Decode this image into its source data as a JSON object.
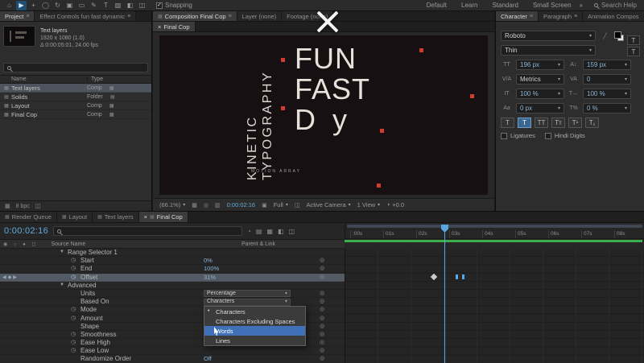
{
  "icons": {
    "menu": "≡",
    "chevron": "▾",
    "twirl": "▼",
    "stopwatch": "◷",
    "pickwhip": "◎",
    "diamond": "◆",
    "nav_left": "◀",
    "nav_right": "▶",
    "dot": "•",
    "close": "×",
    "panel": "▦",
    "check": "✓",
    "folder": "▤",
    "eyedropper": "╱",
    "more": "»",
    "exposure": "◑",
    "target": "◎",
    "grid": "▦",
    "mask": "▥",
    "camera": "▣",
    "view_layout": "◫",
    "col_icons": "◉ ○ ● ◻",
    "tl_icons_1": "◔",
    "tl_icons_2": "▤",
    "tl_icons_3": "▦",
    "tl_icons_4": "◧",
    "tl_icons_5": "◫"
  },
  "menubar": {
    "tools": [
      "⌂",
      "▶",
      "+",
      "◯",
      "↻",
      "▣",
      "▭",
      "✎",
      "T",
      "▨",
      "◧",
      "◫"
    ],
    "snapping": "Snapping",
    "workspaces": [
      "Default",
      "Learn",
      "Standard",
      "Small Screen"
    ],
    "search": "Search Help"
  },
  "project": {
    "tabs": {
      "project": "Project",
      "effects": "Effect Controls fun fast dynamic"
    },
    "info": {
      "name": "Text layers",
      "dims": "1920 x 1080 (1.0)",
      "meta": "Δ 0:00:05:01, 24.00 fps"
    },
    "columns": {
      "name": "Name",
      "type": "Type"
    },
    "rows": [
      {
        "name": "Text layers",
        "type": "Comp"
      },
      {
        "name": "Solids",
        "type": "Folder"
      },
      {
        "name": "Layout",
        "type": "Comp"
      },
      {
        "name": "Final Cop",
        "type": "Comp"
      }
    ],
    "footer": "8 bpc"
  },
  "composition": {
    "tabs": {
      "composition": "Composition Final Cop",
      "layer": "Layer (none)",
      "footage": "Footage (none)"
    },
    "viewer_tab": "Final Cop",
    "canvas": {
      "kinetic": "KINETIC",
      "typography": "TYPOGRAPHY",
      "line1": "FUN",
      "line2": "FAST",
      "line3a": "D",
      "line3b": "y",
      "watermark": "MOTION ARRAY"
    },
    "toolbar": {
      "zoom": "(66.1%)",
      "time": "0:00:02:16",
      "resolution": "Full",
      "camera": "Active Camera",
      "view": "1 View",
      "exposure": "+0.0"
    }
  },
  "character": {
    "tabs": [
      "Character",
      "Paragraph",
      "Animation Compos"
    ],
    "font_family": "Roboto",
    "font_style": "Thin",
    "font_size": "196 px",
    "leading": "159 px",
    "kerning": "Metrics",
    "tracking": "0",
    "vertical_scale": "100 %",
    "horizontal_scale": "100 %",
    "baseline_shift": "0 px",
    "tsume": "0 %",
    "style_buttons": [
      "T",
      "T",
      "TT",
      "Tт",
      "T¹",
      "T₁"
    ],
    "ligatures": "Ligatures",
    "hindi": "Hindi Digits",
    "row_icons": {
      "size": "ΤT",
      "leading": "A↕",
      "kerning": "V/A",
      "tracking": "VA",
      "vscale": "ΙT",
      "hscale": "T↔",
      "baseline": "Aa",
      "tsume": "T%"
    },
    "tile_glyph": "T"
  },
  "timeline": {
    "tabs": [
      "Render Queue",
      "Layout",
      "Text layers",
      "Final Cop"
    ],
    "time": "0:00:02:16",
    "headers": {
      "source": "Source Name",
      "parent": "Parent & Link"
    },
    "rows": [
      {
        "label": "Range Selector 1"
      },
      {
        "label": "Start",
        "value": "0%"
      },
      {
        "label": "End",
        "value": "100%"
      },
      {
        "label": "Offset",
        "value": "31%"
      },
      {
        "label": "Advanced"
      },
      {
        "label": "Units",
        "value": "Percentage"
      },
      {
        "label": "Based On",
        "value": "Characters"
      },
      {
        "label": "Mode"
      },
      {
        "label": "Amount"
      },
      {
        "label": "Shape"
      },
      {
        "label": "Smoothness"
      },
      {
        "label": "Ease High"
      },
      {
        "label": "Ease Low"
      },
      {
        "label": "Randomize Order",
        "value": "Off"
      }
    ],
    "menu": {
      "items": [
        "Characters",
        "Characters Excluding Spaces",
        "Words",
        "Lines"
      ]
    },
    "ruler": [
      ":00s",
      "01s",
      "02s",
      "03s",
      "04s",
      "05s",
      "06s",
      "07s",
      "08s"
    ]
  }
}
